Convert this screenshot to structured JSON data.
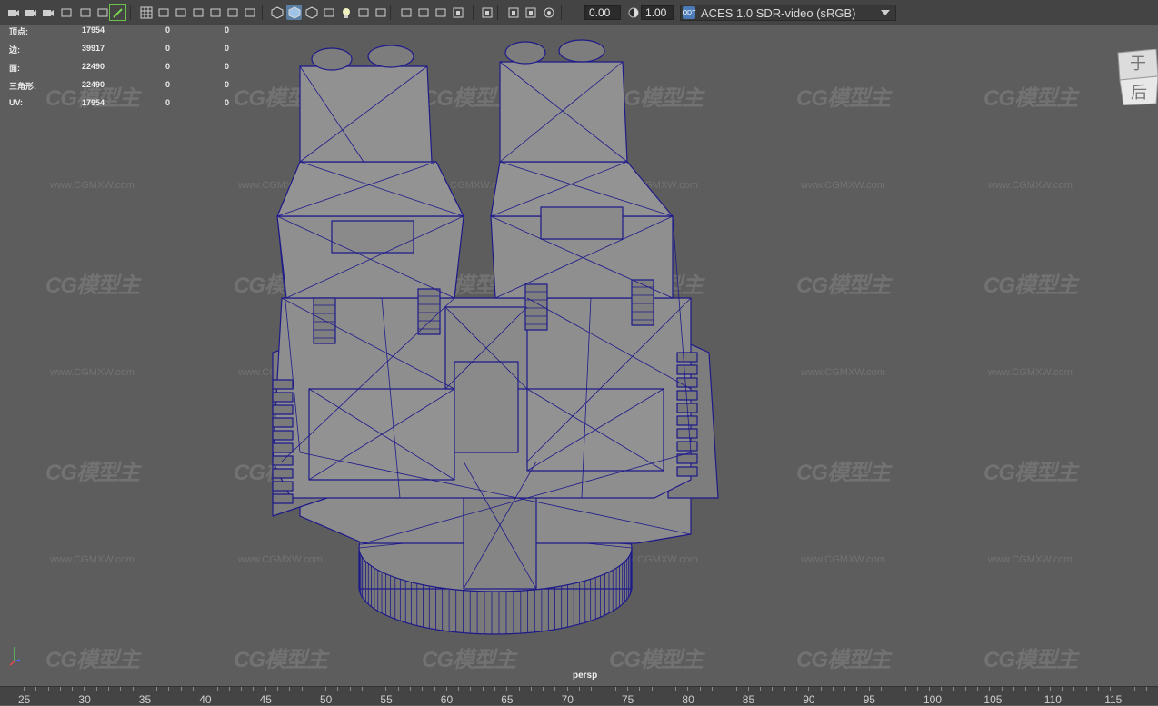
{
  "toolbar": {
    "buttons": [
      {
        "name": "camera-select-icon"
      },
      {
        "name": "camera-attributes-icon"
      },
      {
        "name": "bookmark-camera-icon"
      },
      {
        "name": "bookmark-icon"
      },
      {
        "name": "image-plane-icon"
      },
      {
        "name": "two-d-pan-zoom-icon"
      },
      {
        "name": "grease-pencil-icon"
      },
      {
        "name": "grid-icon"
      },
      {
        "name": "film-gate-icon"
      },
      {
        "name": "resolution-gate-icon"
      },
      {
        "name": "gate-mask-icon"
      },
      {
        "name": "field-chart-icon"
      },
      {
        "name": "safe-action-icon"
      },
      {
        "name": "safe-title-icon"
      },
      {
        "name": "wireframe-icon"
      },
      {
        "name": "smooth-shade-icon"
      },
      {
        "name": "default-material-icon"
      },
      {
        "name": "textured-icon"
      },
      {
        "name": "use-lights-icon"
      },
      {
        "name": "shadows-icon"
      },
      {
        "name": "screen-space-ao-icon"
      },
      {
        "name": "motion-blur-icon"
      },
      {
        "name": "anti-aliasing-icon"
      },
      {
        "name": "depth-of-field-icon"
      },
      {
        "name": "isolate-select-icon"
      },
      {
        "name": "xray-icon"
      },
      {
        "name": "xray-joints-icon"
      },
      {
        "name": "xray-active-icon"
      },
      {
        "name": "exposure-icon"
      }
    ],
    "exposure_value": "0.00",
    "gamma_value": "1.00",
    "color_space": "ACES 1.0 SDR-video (sRGB)",
    "color_space_badge": "ODT"
  },
  "hud": {
    "rows": [
      {
        "label": "顶点:",
        "values": [
          "17954",
          "0",
          "0"
        ]
      },
      {
        "label": "边:",
        "values": [
          "39917",
          "0",
          "0"
        ]
      },
      {
        "label": "面:",
        "values": [
          "22490",
          "0",
          "0"
        ]
      },
      {
        "label": "三角形:",
        "values": [
          "22490",
          "0",
          "0"
        ]
      },
      {
        "label": "UV:",
        "values": [
          "17954",
          "0",
          "0"
        ]
      }
    ]
  },
  "viewport": {
    "camera_label": "persp",
    "wireframe_color": "#1e1a8a",
    "surface_color": "#8e8e8e",
    "background": "#5d5d5d"
  },
  "view_cube": {
    "faces": [
      "于",
      "后"
    ]
  },
  "watermark": {
    "logo": "CG模型主",
    "url": "www.CGMXW.com"
  },
  "timeline": {
    "labels": [
      "25",
      "30",
      "35",
      "40",
      "45",
      "50",
      "55",
      "60",
      "65",
      "70",
      "75",
      "80",
      "85",
      "90",
      "95",
      "100",
      "105",
      "110",
      "115"
    ]
  }
}
